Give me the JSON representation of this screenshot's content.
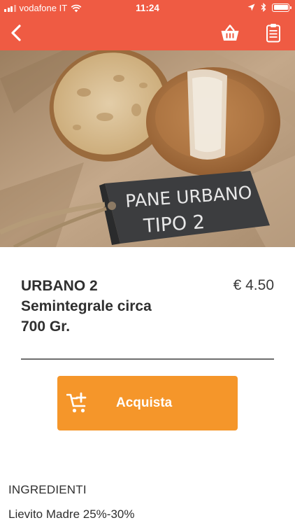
{
  "status_bar": {
    "carrier": "vodafone IT",
    "time": "11:24"
  },
  "nav": {
    "back_icon": "chevron-left-icon",
    "basket_icon": "basket-icon",
    "list_icon": "clipboard-list-icon"
  },
  "hero": {
    "sign_text_line1": "PANE URBANO",
    "sign_text_line2": "TIPO 2"
  },
  "product": {
    "name_line1": "URBANO 2",
    "name_line2": "Semintegrale circa",
    "name_line3": "700 Gr.",
    "price": "€ 4.50"
  },
  "actions": {
    "buy_label": "Acquista",
    "buy_icon": "add-to-cart-icon"
  },
  "details": {
    "ingredients_title": "INGREDIENTI",
    "ingredients": [
      "Lievito Madre 25%-30%"
    ]
  },
  "colors": {
    "header": "#ef5b43",
    "buy_button": "#f5962a",
    "text": "#2f2f2f"
  }
}
